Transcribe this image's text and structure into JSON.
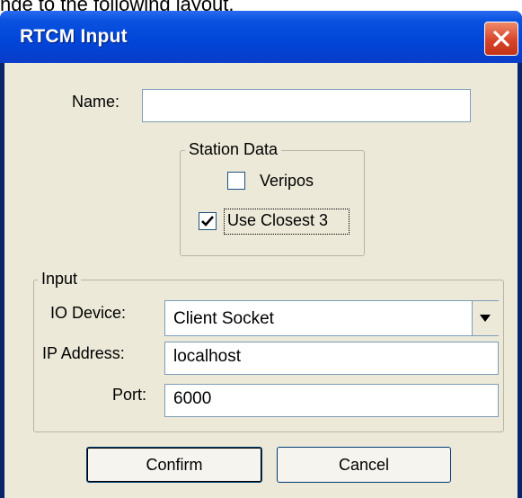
{
  "header_text": "nge to the following layout.",
  "window": {
    "title": "RTCM Input",
    "close_icon": "close-icon"
  },
  "form": {
    "name_label": "Name:",
    "name_value": ""
  },
  "station_data": {
    "title": "Station Data",
    "veripos_label": "Veripos",
    "veripos_checked": false,
    "use_closest_label": "Use Closest 3",
    "use_closest_checked": true
  },
  "input": {
    "title": "Input",
    "io_device_label": "IO Device:",
    "io_device_value": "Client Socket",
    "ip_address_label": "IP Address:",
    "ip_address_value": "localhost",
    "port_label": "Port:",
    "port_value": "6000"
  },
  "buttons": {
    "confirm": "Confirm",
    "cancel": "Cancel"
  }
}
